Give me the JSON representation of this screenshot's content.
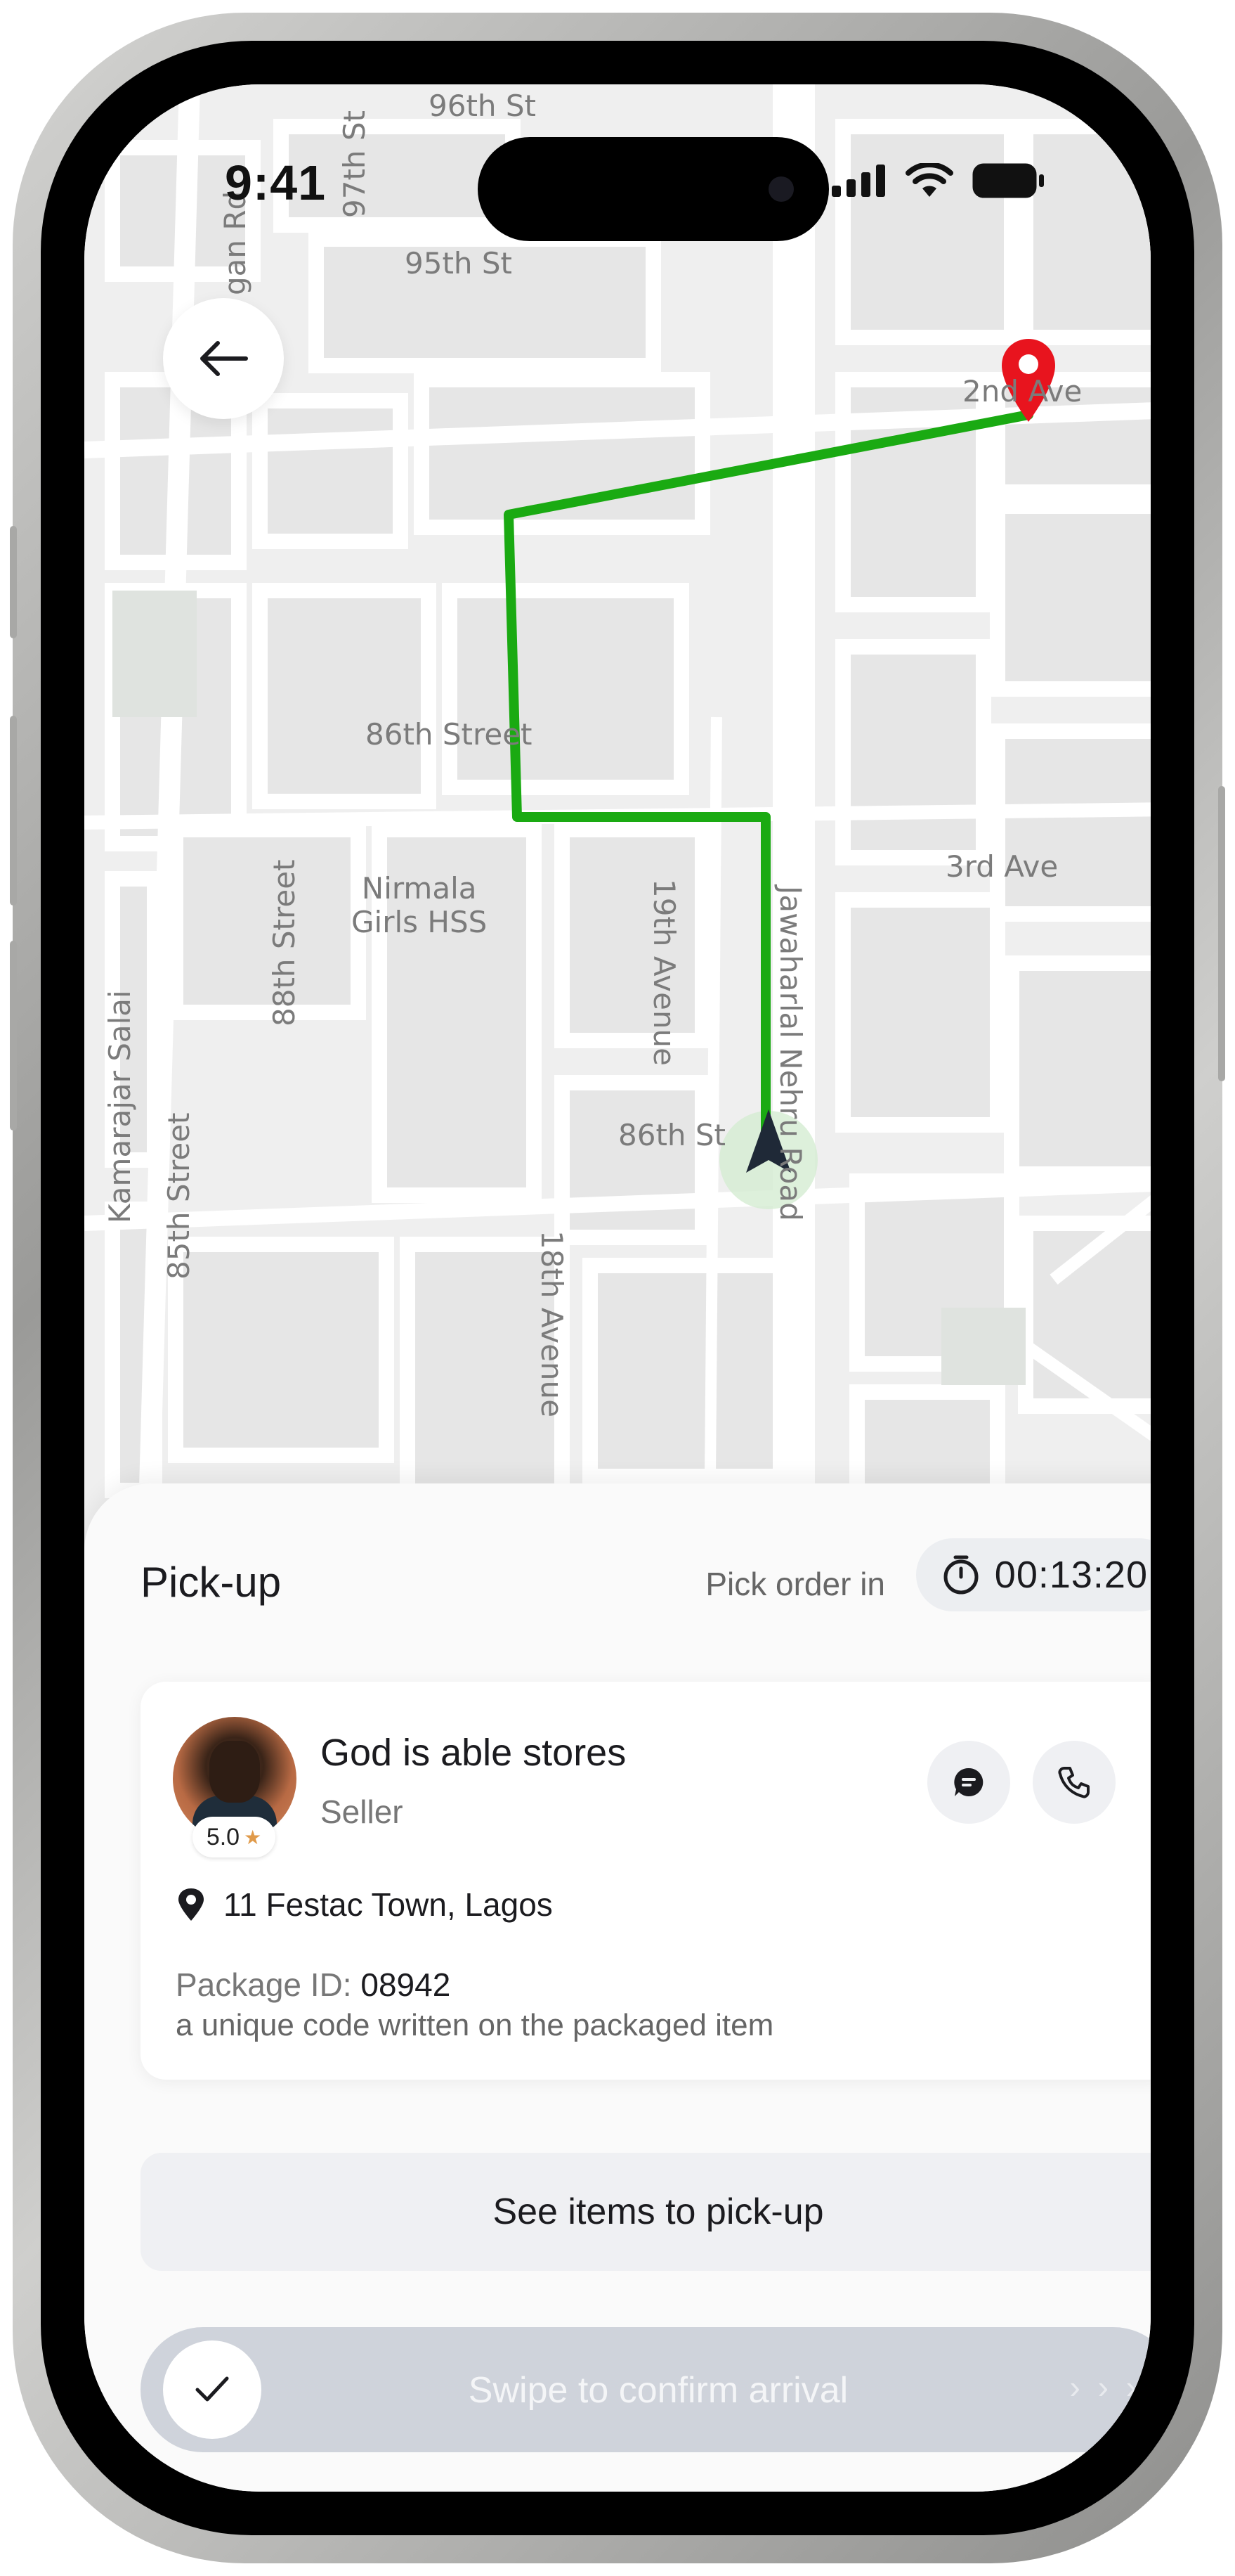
{
  "status_bar": {
    "time": "9:41"
  },
  "map": {
    "streets": [
      "96th St",
      "95th St",
      "2nd Ave",
      "86th Street",
      "3rd Ave",
      "86th St",
      "Kamarajar Salai",
      "88th Street",
      "85th Street",
      "19th Avenue",
      "18th Avenue",
      "97th St",
      "gan Rd",
      "Jawaharlal Nehru Road"
    ],
    "landmark": [
      "Nirmala",
      "Girls HSS"
    ],
    "route_color": "#1aaa12",
    "destination_pin_color": "#e8141e"
  },
  "sheet": {
    "title": "Pick-up",
    "pick_label": "Pick order in",
    "timer": "00:13:20"
  },
  "seller": {
    "name": "God is able stores",
    "role": "Seller",
    "rating": "5.0",
    "address": "11 Festac Town, Lagos",
    "package_label": "Package ID:",
    "package_id": "08942",
    "package_note": "a unique code written on the packaged item"
  },
  "actions": {
    "see_items": "See items to pick-up",
    "swipe": "Swipe to confirm arrival",
    "swipe_arrows": "› › ›"
  },
  "icons": {
    "back": "arrow-left-icon",
    "chat": "chat-icon",
    "phone": "phone-icon",
    "location": "location-pin-icon",
    "timer": "stopwatch-icon",
    "check": "check-icon"
  }
}
